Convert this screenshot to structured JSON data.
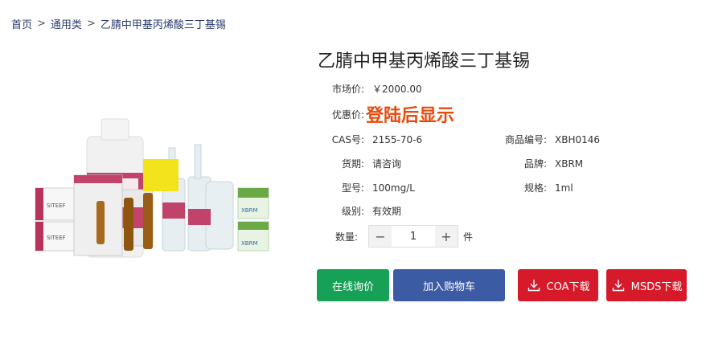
{
  "breadcrumb": {
    "home": "首页",
    "separator": ">",
    "category": "通用类",
    "current": "乙腈中甲基丙烯酸三丁基锡"
  },
  "product": {
    "title": "乙腈中甲基丙烯酸三丁基锡",
    "market_price_label": "市场价:",
    "market_price": "￥2000.00",
    "discount_label": "优惠价:",
    "discount_value": "登陆后显示",
    "cas_label": "CAS号:",
    "cas": "2155-70-6",
    "code_label": "商品编号:",
    "code": "XBH0146",
    "stock_label": "货期:",
    "stock": "请咨询",
    "brand_label": "品牌:",
    "brand": "XBRM",
    "model_label": "型号:",
    "model": "100mg/L",
    "spec_label": "规格:",
    "spec": "1ml",
    "grade_label": "级别:",
    "grade": "有效期",
    "qty_label": "数量:",
    "qty_value": "1",
    "qty_unit": "件",
    "image_labels": {
      "box_brand": "SITEEF",
      "logo_text": "XBRM"
    }
  },
  "buttons": {
    "inquiry": "在线询价",
    "cart": "加入购物车",
    "coa": "COA下载",
    "msds": "MSDS下载",
    "minus": "−",
    "plus": "+"
  },
  "colors": {
    "green": "#17a156",
    "blue": "#3b5ba5",
    "red": "#d61a2a",
    "price_orange": "#e84a0c"
  }
}
